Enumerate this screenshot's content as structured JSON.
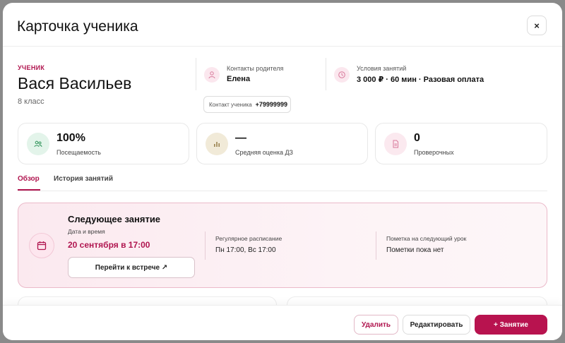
{
  "modal": {
    "title": "Карточка ученика",
    "close_label": "×"
  },
  "student": {
    "eyebrow": "УЧЕНИК",
    "name": "Вася Васильев",
    "grade": "8 класс"
  },
  "parent_contacts": {
    "label": "Контакты родителя",
    "value": "Елена"
  },
  "lesson_terms": {
    "label": "Условия занятий",
    "value": "3 000 ₽ · 60 мин · Разовая оплата"
  },
  "student_contact": {
    "label": "Контакт ученика",
    "value": "+79999999"
  },
  "stats": [
    {
      "value": "100%",
      "label": "Посещаемость",
      "icon": "users-icon"
    },
    {
      "value": "—",
      "label": "Средняя оценка ДЗ",
      "icon": "bar-chart-icon"
    },
    {
      "value": "0",
      "label": "Проверочных",
      "icon": "document-icon"
    }
  ],
  "tabs": [
    {
      "label": "Обзор",
      "active": true
    },
    {
      "label": "История занятий",
      "active": false
    }
  ],
  "next_lesson": {
    "title": "Следующее занятие",
    "datetime_label": "Дата и время",
    "datetime_value": "20 сентября в 17:00",
    "go_button": "Перейти к встрече ↗",
    "schedule_label": "Регулярное расписание",
    "schedule_value": "Пн 17:00, Вс 17:00",
    "note_label": "Пометка на следующий урок",
    "note_value": "Пометки пока нет"
  },
  "footer": {
    "delete_label": "Удалить",
    "edit_label": "Редактировать",
    "add_label": "+ Занятие"
  },
  "colors": {
    "accent": "#b8134f",
    "accent_text": "#b0154f",
    "stat_green_bg": "#e3f4ea",
    "stat_olive_bg": "#f1ead8",
    "stat_pink_bg": "#fbe9ef"
  }
}
